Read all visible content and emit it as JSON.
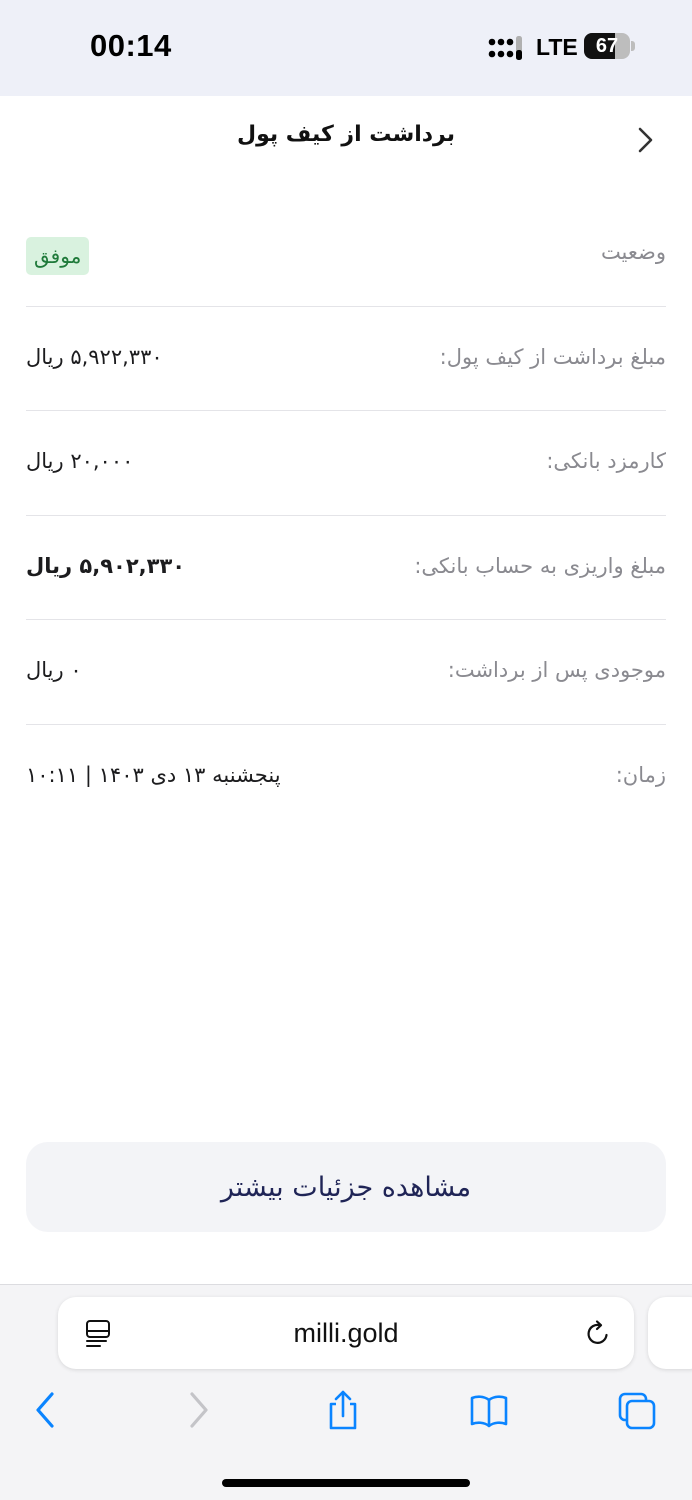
{
  "status_bar": {
    "time": "00:14",
    "network": "LTE",
    "battery_level": "67",
    "battery_fraction": 0.67
  },
  "header": {
    "title": "برداشت از کیف پول",
    "back_icon": "chevron-right-icon"
  },
  "details": {
    "status": {
      "label": "وضعیت",
      "value": "موفق",
      "color": "#1f7a3a",
      "background": "#d9f2df"
    },
    "withdraw_amount": {
      "label": "مبلغ برداشت از کیف پول:",
      "value": "۵,۹۲۲,۳۳۰ ریال"
    },
    "bank_fee": {
      "label": "کارمزد بانکی:",
      "value": "۲۰,۰۰۰ ریال"
    },
    "deposit_amount": {
      "label": "مبلغ واریزی به حساب بانکی:",
      "value": "۵,۹۰۲,۳۳۰ ریال"
    },
    "balance_after": {
      "label": "موجودی پس از برداشت:",
      "value": "۰ ریال"
    },
    "time": {
      "label": "زمان:",
      "value": "پنجشنبه ۱۳ دی ۱۴۰۳ | ۱۰:۱۱"
    }
  },
  "actions": {
    "more_details_label": "مشاهده جزئیات بیشتر"
  },
  "browser": {
    "url": "milli.gold",
    "icons": [
      "reader-icon",
      "reload-icon",
      "back-icon",
      "forward-icon",
      "share-icon",
      "bookmarks-icon",
      "tabs-icon"
    ],
    "accent_color": "#0a84ff"
  }
}
